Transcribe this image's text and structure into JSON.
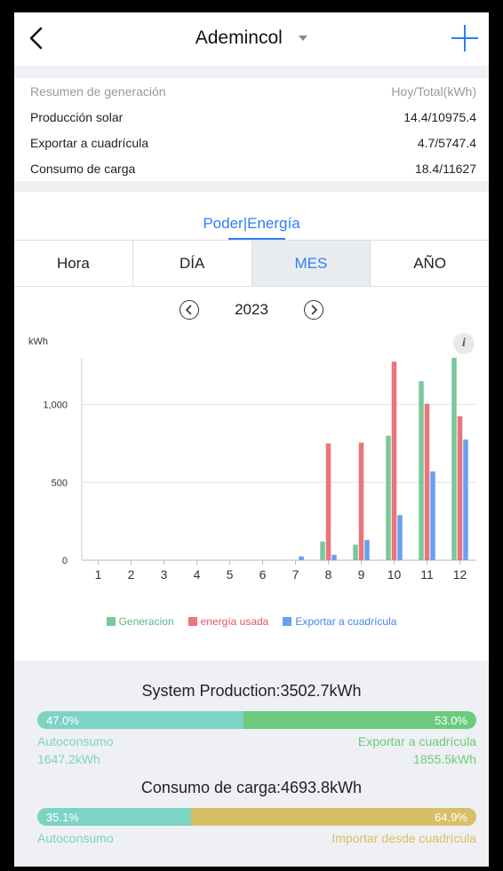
{
  "header": {
    "title": "Ademincol"
  },
  "summary": {
    "header_label": "Resumen de generación",
    "header_value": "Hoy/Total(kWh)",
    "rows": [
      {
        "label": "Producción solar",
        "value": "14.4/10975.4"
      },
      {
        "label": "Exportar a cuadrícula",
        "value": "4.7/5747.4"
      },
      {
        "label": "Consumo de carga",
        "value": "18.4/11627"
      }
    ]
  },
  "view_title": "Poder|Energía",
  "segments": [
    "Hora",
    "DÍA",
    "MES",
    "AÑO"
  ],
  "active_segment": "MES",
  "year": "2023",
  "colors": {
    "generation": "#7cc69b",
    "used": "#e8767a",
    "export": "#6aa0ef",
    "accent": "#2f7df6",
    "teal": "#7dd3c4",
    "green": "#6cca7e",
    "gold": "#d8bf67"
  },
  "chart_data": {
    "type": "bar",
    "ylabel": "kWh",
    "ylim": [
      0,
      1300
    ],
    "yticks": [
      "0",
      "500",
      "1,000"
    ],
    "categories": [
      "1",
      "2",
      "3",
      "4",
      "5",
      "6",
      "7",
      "8",
      "9",
      "10",
      "11",
      "12"
    ],
    "series": [
      {
        "name": "Generacion",
        "values": [
          0,
          0,
          0,
          0,
          0,
          0,
          0,
          120,
          100,
          800,
          1150,
          1300
        ]
      },
      {
        "name": "energía usada",
        "values": [
          0,
          0,
          0,
          0,
          0,
          0,
          0,
          750,
          755,
          1275,
          1005,
          925
        ]
      },
      {
        "name": "Exportar a cuadrícula",
        "values": [
          0,
          0,
          0,
          0,
          0,
          0,
          25,
          35,
          130,
          290,
          570,
          775
        ]
      }
    ]
  },
  "production": {
    "title": "System Production:3502.7kWh",
    "left_pct": "47.0%",
    "right_pct": "53.0%",
    "left_fraction": 0.47,
    "left_label": "Autoconsumo",
    "right_label": "Exportar a cuadrícula",
    "left_value": "1647.2kWh",
    "right_value": "1855.5kWh"
  },
  "consumption": {
    "title": "Consumo de carga:4693.8kWh",
    "left_pct": "35.1%",
    "right_pct": "64.9%",
    "left_fraction": 0.351,
    "left_label": "Autoconsumo",
    "right_label": "Importar desde cuadrícula"
  }
}
